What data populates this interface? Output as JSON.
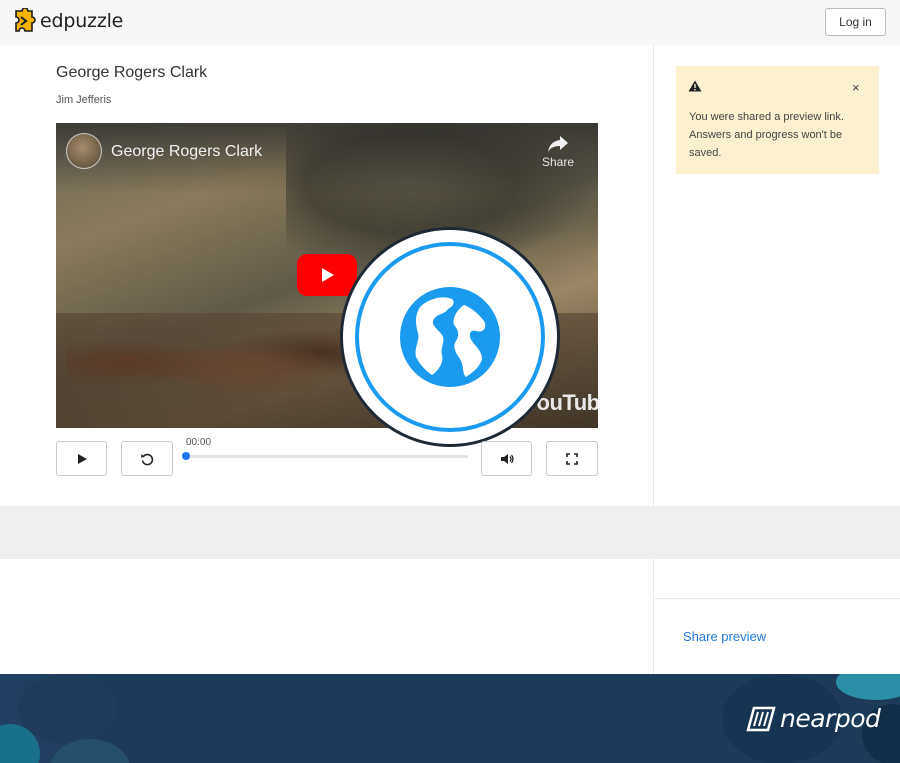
{
  "header": {
    "logo_text": "edpuzzle",
    "login_label": "Log in"
  },
  "video": {
    "title": "George Rogers Clark",
    "author": "Jim Jefferis",
    "player_title": "George Rogers Clark",
    "share_label": "Share",
    "youtube_word": "YouTube"
  },
  "controls": {
    "time": "00:00",
    "progress": 0
  },
  "notice": {
    "message": "You were shared a preview link. Answers and progress won't be saved.",
    "close_glyph": "×"
  },
  "sidebar": {
    "share_preview_label": "Share preview"
  },
  "footer": {
    "brand": "nearpod"
  },
  "colors": {
    "accent_blue": "#1a9bef",
    "link_blue": "#1f77d8",
    "notice_bg": "#fdf0cf",
    "footer_bg": "#1c3a5a"
  }
}
